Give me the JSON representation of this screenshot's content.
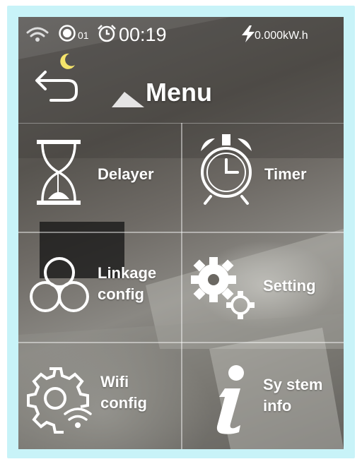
{
  "status_bar": {
    "wifi_icon": "wifi-icon",
    "record_icon": "record-icon",
    "channel": "01",
    "alarm_icon": "alarm-clock-icon",
    "time": "00:19",
    "power_icon": "lightning-icon",
    "energy": "0.000kW.h"
  },
  "header": {
    "back_icon": "back-arrow-icon",
    "night_icon": "crescent-moon-icon",
    "title": "Menu"
  },
  "menu": {
    "items": [
      {
        "label_lines": [
          "Delayer"
        ],
        "icon": "hourglass-icon"
      },
      {
        "label_lines": [
          "Timer"
        ],
        "icon": "alarm-clock-icon"
      },
      {
        "label_lines": [
          "Linkage",
          "config"
        ],
        "icon": "linkage-cycle-icon"
      },
      {
        "label_lines": [
          "Setting"
        ],
        "icon": "gears-icon"
      },
      {
        "label_lines": [
          "Wifi",
          "config"
        ],
        "icon": "wifi-gear-icon"
      },
      {
        "label_lines": [
          "Sy stem",
          "info"
        ],
        "icon": "info-icon"
      }
    ]
  },
  "colors": {
    "frame": "#c8f3f8",
    "foreground": "#ffffff",
    "moon": "#f5e46b"
  }
}
